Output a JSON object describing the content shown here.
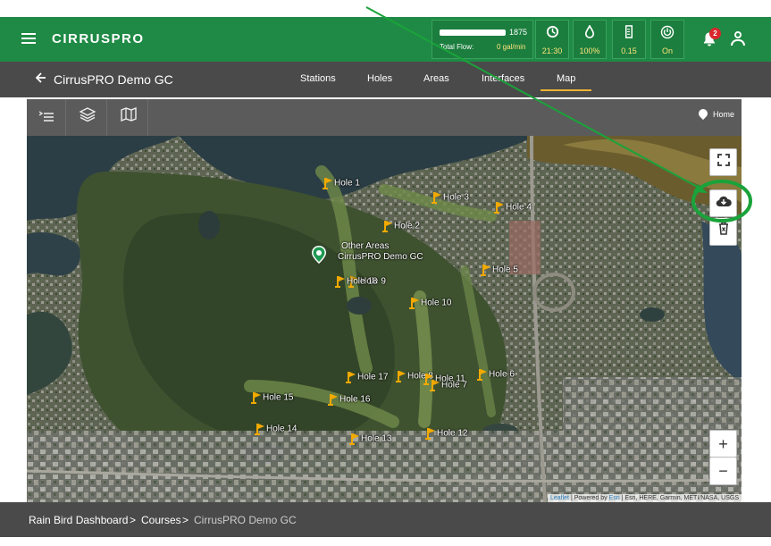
{
  "header": {
    "logo_prefix": "CIRRUS",
    "logo_suffix": "PRO",
    "flow_max": "1875",
    "total_flow_label": "Total Flow:",
    "total_flow_value": "0 gal/min",
    "stats": [
      {
        "icon": "clock-icon",
        "value": "21:30"
      },
      {
        "icon": "water-drop-icon",
        "value": "100%"
      },
      {
        "icon": "gauge-icon",
        "value": "0.15"
      },
      {
        "icon": "power-icon",
        "value": "On"
      }
    ],
    "notification_count": "2"
  },
  "subnav": {
    "course_name": "CirrusPRO Demo GC",
    "tabs": [
      {
        "label": "Stations",
        "active": false
      },
      {
        "label": "Holes",
        "active": false
      },
      {
        "label": "Areas",
        "active": false
      },
      {
        "label": "Interfaces",
        "active": false
      },
      {
        "label": "Map",
        "active": true
      }
    ]
  },
  "toolbar": {
    "home_label": "Home"
  },
  "map": {
    "course_label": "CirrusPRO Demo GC",
    "other_areas_label": "Other Areas",
    "holes": [
      {
        "label": "Hole 1"
      },
      {
        "label": "Hole 2"
      },
      {
        "label": "Hole 3"
      },
      {
        "label": "Hole 4"
      },
      {
        "label": "Hole 5"
      },
      {
        "label": "Hole 6"
      },
      {
        "label": "Hole 7"
      },
      {
        "label": "Hole 8"
      },
      {
        "label": "Hole 9"
      },
      {
        "label": "Hole 10"
      },
      {
        "label": "Hole 11"
      },
      {
        "label": "Hole 12"
      },
      {
        "label": "Hole 13"
      },
      {
        "label": "Hole 14"
      },
      {
        "label": "Hole 15"
      },
      {
        "label": "Hole 16"
      },
      {
        "label": "Hole 17"
      },
      {
        "label": "Hole 18"
      }
    ],
    "zoom_in": "+",
    "zoom_out": "−",
    "attribution_leaflet": "Leaflet",
    "attribution_powered": "| Powered by",
    "attribution_esri": "Esri",
    "attribution_sources": "| Esri, HERE, Garmin, METI/NASA, USGS"
  },
  "breadcrumbs": {
    "items": [
      "Rain Bird Dashboard",
      ">",
      "Courses",
      ">",
      "CirrusPRO Demo GC"
    ]
  },
  "colors": {
    "header_green": "#1f8a45",
    "accent_yellow": "#f2b233",
    "flag_orange": "#f2a900",
    "annotation_green": "#1aa33a"
  }
}
